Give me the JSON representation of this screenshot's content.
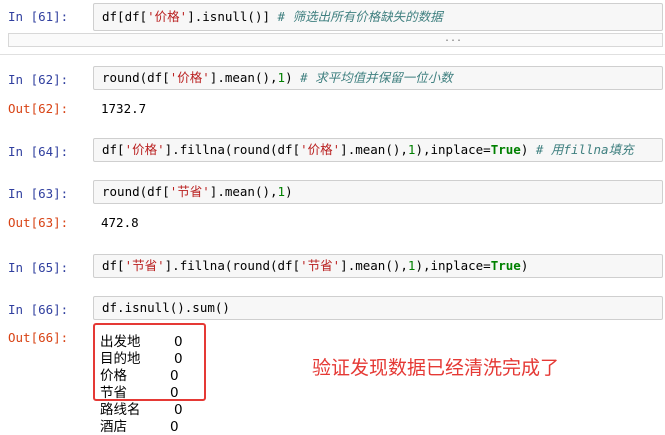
{
  "cells": [
    {
      "prompt": "In  [61]:",
      "code": "df[df['价格'].isnull()] # 筛选出所有价格缺失的数据"
    },
    {
      "prompt": "In  [62]:",
      "code": "round(df['价格'].mean(),1) # 求平均值并保留一位小数",
      "out_prompt": "Out[62]:",
      "output": "1732.7"
    },
    {
      "prompt": "In  [64]:",
      "code": "df['价格'].fillna(round(df['价格'].mean(),1),inplace=True) # 用fillna填充"
    },
    {
      "prompt": "In  [63]:",
      "code": "round(df['节省'].mean(),1)",
      "out_prompt": "Out[63]:",
      "output": "472.8"
    },
    {
      "prompt": "In  [65]:",
      "code": "df['节省'].fillna(round(df['节省'].mean(),1),inplace=True)"
    },
    {
      "prompt": "In  [66]:",
      "code": "df.isnull().sum()",
      "out_prompt": "Out[66]:"
    }
  ],
  "collapsed_marker": "...",
  "null_counts": [
    {
      "column": "出发地",
      "value": "0"
    },
    {
      "column": "目的地",
      "value": "0"
    },
    {
      "column": "价格",
      "value": "0"
    },
    {
      "column": "节省",
      "value": "0"
    },
    {
      "column": "路线名",
      "value": "0"
    },
    {
      "column": "酒店",
      "value": "0"
    }
  ],
  "annotation": "验证发现数据已经清洗完成了",
  "colors": {
    "annotation": "#e53935",
    "selected_cell_bar": "#66bb6a",
    "in_prompt": "#303f9f",
    "out_prompt": "#d84315"
  }
}
